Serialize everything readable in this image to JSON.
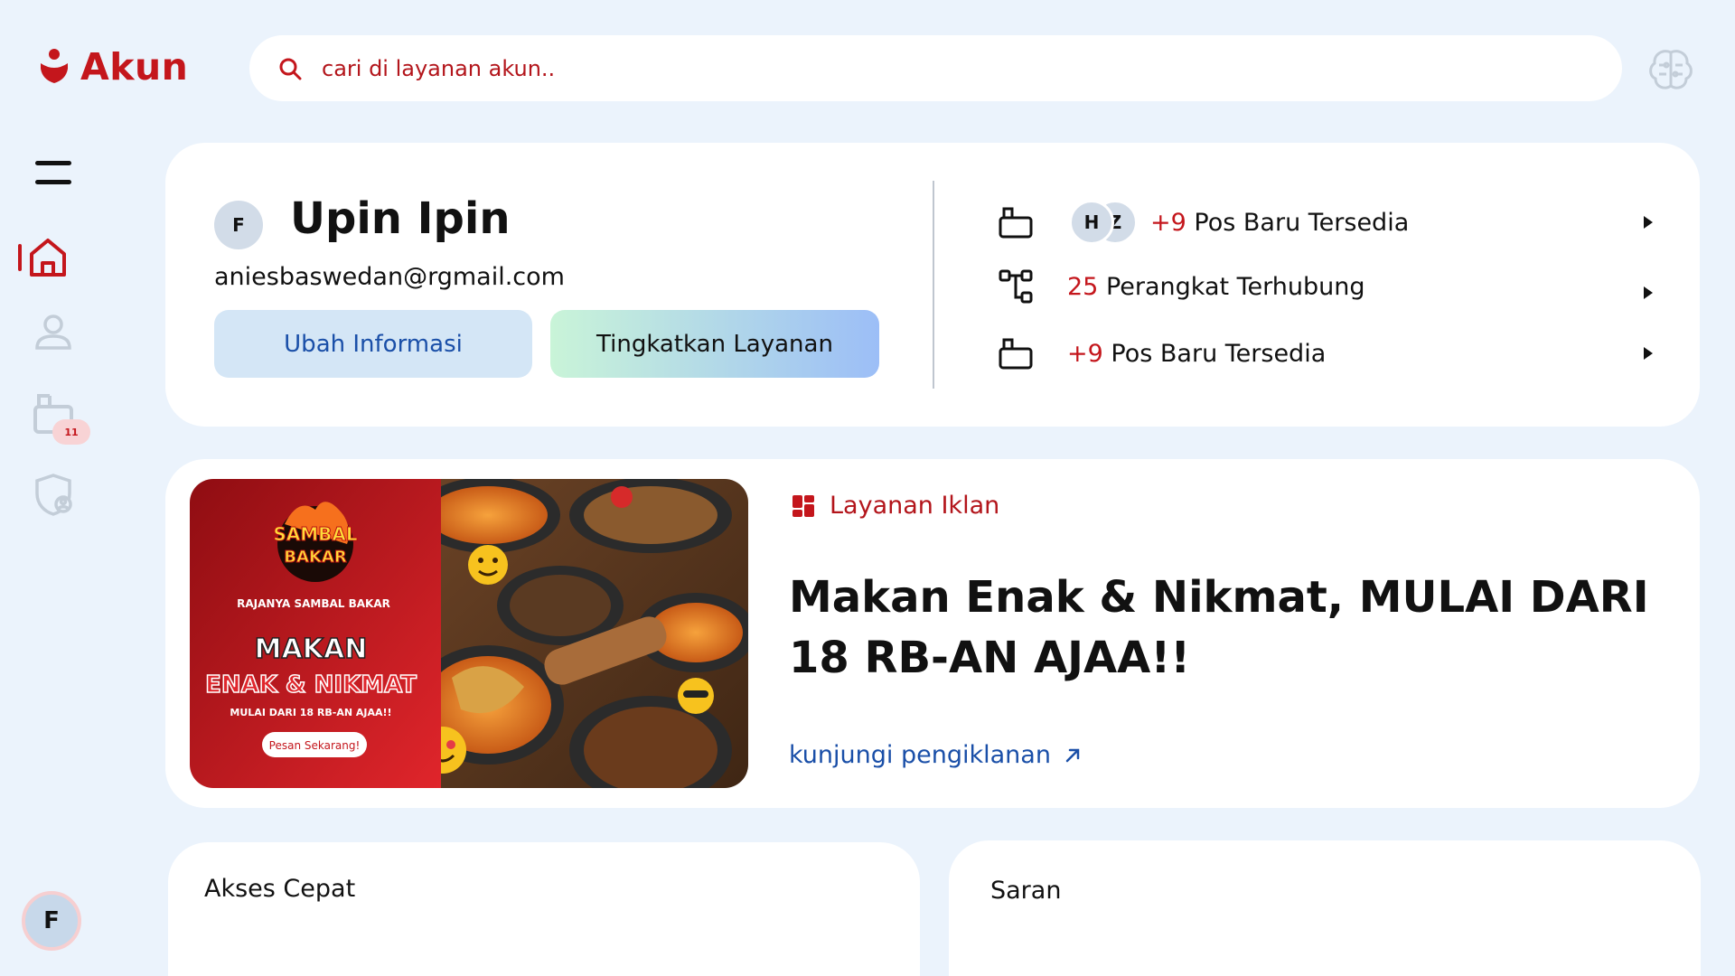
{
  "app": {
    "name": "Akun"
  },
  "search": {
    "placeholder": "cari di layanan akun.."
  },
  "sidebar": {
    "posts_badge": "11",
    "avatar_initial": "F",
    "items": [
      {
        "icon": "menu-icon"
      },
      {
        "icon": "home-icon",
        "active": true
      },
      {
        "icon": "user-icon"
      },
      {
        "icon": "posts-icon"
      },
      {
        "icon": "shield-icon"
      }
    ]
  },
  "profile": {
    "initial": "F",
    "name": "Upin Ipin",
    "email": "aniesbaswedan@rgmail.com",
    "edit_button": "Ubah Informasi",
    "upgrade_button": "Tingkatkan Layanan"
  },
  "stats": [
    {
      "number": "+9",
      "label": "Pos Baru Tersedia",
      "avatars": [
        "H",
        "Z"
      ]
    },
    {
      "number": "25",
      "label": "Perangkat Terhubung"
    },
    {
      "number": "+9",
      "label": "Pos Baru Tersedia"
    }
  ],
  "ad": {
    "label": "Layanan Iklan",
    "headline": "Makan Enak & Nikmat, MULAI DARI 18 RB-AN AJAA!!",
    "link": "kunjungi pengiklanan",
    "image": {
      "brand_line1": "SAMBAL",
      "brand_line2": "BAKAR",
      "tagline": "RAJANYA SAMBAL BAKAR",
      "title1": "MAKAN",
      "title2": "ENAK & NIKMAT",
      "subtitle": "MULAI DARI 18 RB-AN AJAA!!",
      "cta": "Pesan Sekarang!"
    }
  },
  "sections": {
    "quick_access": "Akses Cepat",
    "suggestions": "Saran"
  },
  "colors": {
    "background": "#ebf3fc",
    "brand": "#c4161c",
    "link": "#1a4fa8"
  }
}
